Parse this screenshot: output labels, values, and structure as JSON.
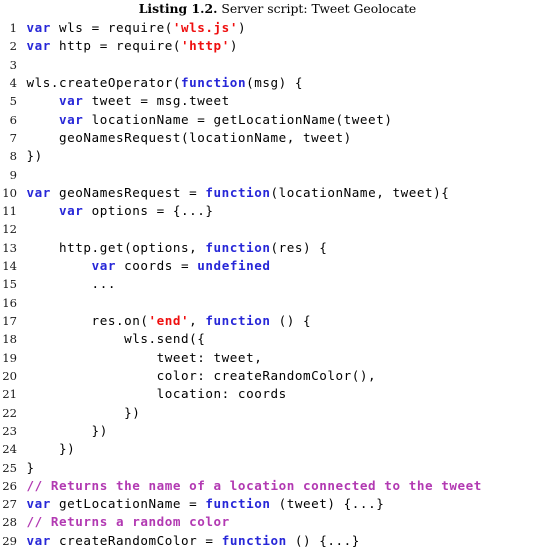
{
  "caption": {
    "label": "Listing 1.2.",
    "text": "Server script: Tweet Geolocate"
  },
  "colors": {
    "keyword": "#2727d8",
    "string": "#ef0f0f",
    "comment": "#b239b2",
    "plain": "#000000",
    "lineno": "#1a1a1a",
    "background": "#ffffff"
  },
  "listing": {
    "language": "javascript",
    "first_line": 1,
    "last_line": 29,
    "lines": [
      {
        "n": "1",
        "tokens": [
          {
            "t": "kw",
            "s": "var"
          },
          {
            "t": "txt",
            "s": " wls = require("
          },
          {
            "t": "str",
            "s": "'wls.js'"
          },
          {
            "t": "txt",
            "s": ")"
          }
        ]
      },
      {
        "n": "2",
        "tokens": [
          {
            "t": "kw",
            "s": "var"
          },
          {
            "t": "txt",
            "s": " http = require("
          },
          {
            "t": "str",
            "s": "'http'"
          },
          {
            "t": "txt",
            "s": ")"
          }
        ]
      },
      {
        "n": "3",
        "tokens": []
      },
      {
        "n": "4",
        "tokens": [
          {
            "t": "txt",
            "s": "wls.createOperator("
          },
          {
            "t": "kw",
            "s": "function"
          },
          {
            "t": "txt",
            "s": "(msg) {"
          }
        ]
      },
      {
        "n": "5",
        "tokens": [
          {
            "t": "txt",
            "s": "    "
          },
          {
            "t": "kw",
            "s": "var"
          },
          {
            "t": "txt",
            "s": " tweet = msg.tweet"
          }
        ]
      },
      {
        "n": "6",
        "tokens": [
          {
            "t": "txt",
            "s": "    "
          },
          {
            "t": "kw",
            "s": "var"
          },
          {
            "t": "txt",
            "s": " locationName = getLocationName(tweet)"
          }
        ]
      },
      {
        "n": "7",
        "tokens": [
          {
            "t": "txt",
            "s": "    geoNamesRequest(locationName, tweet)"
          }
        ]
      },
      {
        "n": "8",
        "tokens": [
          {
            "t": "txt",
            "s": "})"
          }
        ]
      },
      {
        "n": "9",
        "tokens": []
      },
      {
        "n": "10",
        "tokens": [
          {
            "t": "kw",
            "s": "var"
          },
          {
            "t": "txt",
            "s": " geoNamesRequest = "
          },
          {
            "t": "kw",
            "s": "function"
          },
          {
            "t": "txt",
            "s": "(locationName, tweet){"
          }
        ]
      },
      {
        "n": "11",
        "tokens": [
          {
            "t": "txt",
            "s": "    "
          },
          {
            "t": "kw",
            "s": "var"
          },
          {
            "t": "txt",
            "s": " options = {...}"
          }
        ]
      },
      {
        "n": "12",
        "tokens": []
      },
      {
        "n": "13",
        "tokens": [
          {
            "t": "txt",
            "s": "    http.get(options, "
          },
          {
            "t": "kw",
            "s": "function"
          },
          {
            "t": "txt",
            "s": "(res) {"
          }
        ]
      },
      {
        "n": "14",
        "tokens": [
          {
            "t": "txt",
            "s": "        "
          },
          {
            "t": "kw",
            "s": "var"
          },
          {
            "t": "txt",
            "s": " coords = "
          },
          {
            "t": "kw",
            "s": "undefined"
          }
        ]
      },
      {
        "n": "15",
        "tokens": [
          {
            "t": "txt",
            "s": "        ..."
          }
        ]
      },
      {
        "n": "16",
        "tokens": []
      },
      {
        "n": "17",
        "tokens": [
          {
            "t": "txt",
            "s": "        res.on("
          },
          {
            "t": "str",
            "s": "'end'"
          },
          {
            "t": "txt",
            "s": ", "
          },
          {
            "t": "kw",
            "s": "function"
          },
          {
            "t": "txt",
            "s": " () {"
          }
        ]
      },
      {
        "n": "18",
        "tokens": [
          {
            "t": "txt",
            "s": "            wls.send({"
          }
        ]
      },
      {
        "n": "19",
        "tokens": [
          {
            "t": "txt",
            "s": "                tweet: tweet,"
          }
        ]
      },
      {
        "n": "20",
        "tokens": [
          {
            "t": "txt",
            "s": "                color: createRandomColor(),"
          }
        ]
      },
      {
        "n": "21",
        "tokens": [
          {
            "t": "txt",
            "s": "                location: coords"
          }
        ]
      },
      {
        "n": "22",
        "tokens": [
          {
            "t": "txt",
            "s": "            })"
          }
        ]
      },
      {
        "n": "23",
        "tokens": [
          {
            "t": "txt",
            "s": "        })"
          }
        ]
      },
      {
        "n": "24",
        "tokens": [
          {
            "t": "txt",
            "s": "    })"
          }
        ]
      },
      {
        "n": "25",
        "tokens": [
          {
            "t": "txt",
            "s": "}"
          }
        ]
      },
      {
        "n": "26",
        "tokens": [
          {
            "t": "com",
            "s": "// Returns the name of a location connected to the tweet"
          }
        ]
      },
      {
        "n": "27",
        "tokens": [
          {
            "t": "kw",
            "s": "var"
          },
          {
            "t": "txt",
            "s": " getLocationName = "
          },
          {
            "t": "kw",
            "s": "function"
          },
          {
            "t": "txt",
            "s": " (tweet) {...}"
          }
        ]
      },
      {
        "n": "28",
        "tokens": [
          {
            "t": "com",
            "s": "// Returns a random color"
          }
        ]
      },
      {
        "n": "29",
        "tokens": [
          {
            "t": "kw",
            "s": "var"
          },
          {
            "t": "txt",
            "s": " createRandomColor = "
          },
          {
            "t": "kw",
            "s": "function"
          },
          {
            "t": "txt",
            "s": " () {...}"
          }
        ]
      }
    ]
  }
}
